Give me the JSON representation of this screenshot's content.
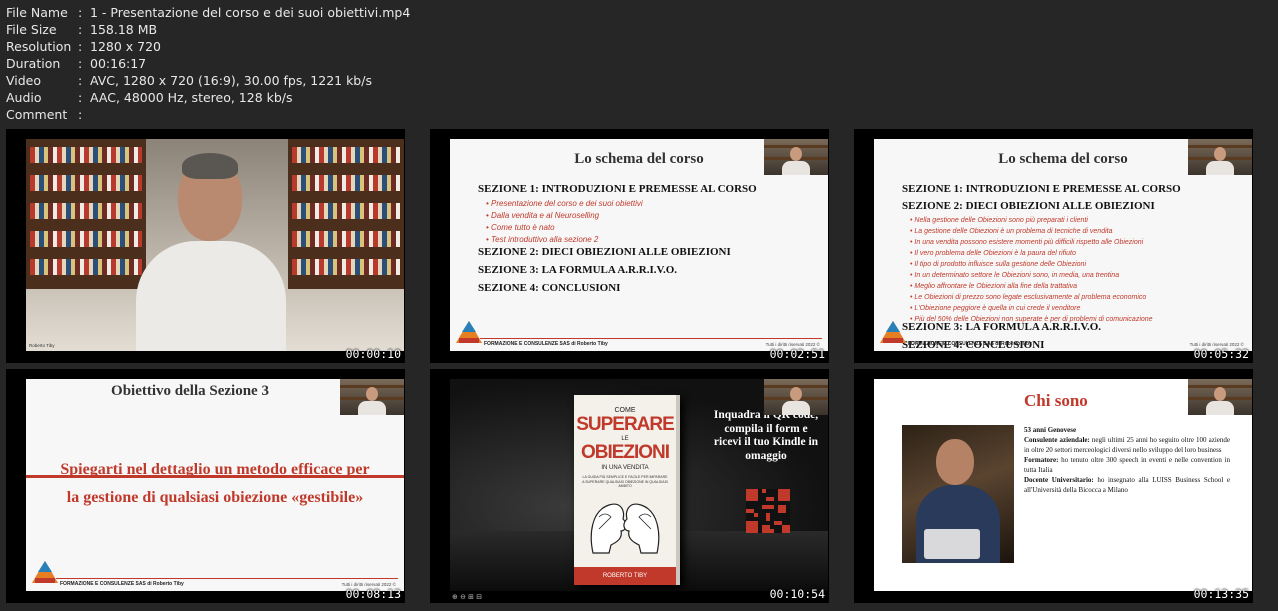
{
  "file_info": [
    {
      "key": "File Name",
      "value": "1 - Presentazione del corso e dei suoi obiettivi.mp4"
    },
    {
      "key": "File Size",
      "value": "158.18 MB"
    },
    {
      "key": "Resolution",
      "value": "1280 x 720"
    },
    {
      "key": "Duration",
      "value": "00:16:17"
    },
    {
      "key": "Video",
      "value": "AVC, 1280 x 720 (16:9), 30.00 fps, 1221 kb/s"
    },
    {
      "key": "Audio",
      "value": "AAC, 48000 Hz, stereo, 128 kb/s"
    },
    {
      "key": "Comment",
      "value": ""
    }
  ],
  "separator": ":",
  "thumbnails": [
    {
      "timestamp": "00:00:10",
      "name_tag": "Roberto Tiby"
    },
    {
      "timestamp": "00:02:51"
    },
    {
      "timestamp": "00:05:32"
    },
    {
      "timestamp": "00:08:13"
    },
    {
      "timestamp": "00:10:54"
    },
    {
      "timestamp": "00:13:35"
    }
  ],
  "slides": {
    "footer": "FORMAZIONE E CONSULENZE SAS di Roberto Tiby",
    "footer_right": "Tutti i diritti riservati 2022 ©",
    "schema": {
      "title": "Lo schema del corso",
      "s1": "SEZIONE 1: INTRODUZIONI E PREMESSE AL CORSO",
      "s1_bullets": [
        "Presentazione del corso e dei suoi obiettivi",
        "Dalla vendita e al Neuroselling",
        "Come tutto è nato",
        "Test introduttivo alla sezione 2"
      ],
      "s2": "SEZIONE 2: DIECI OBIEZIONI ALLE OBIEZIONI",
      "s2_bullets": [
        "Nella gestione delle Obiezioni sono più preparati i clienti",
        "La gestione delle Obiezioni è un problema di tecniche di vendita",
        "In una vendita possono esistere momenti più difficili rispetto alle Obiezioni",
        "Il vero problema delle Obiezioni è la paura del rifiuto",
        "Il tipo di prodotto influisce sulla gestione delle Obiezioni",
        "In un determinato settore le Obiezioni sono, in media, una trentina",
        "Meglio affrontare le Obiezioni alla fine della trattativa",
        "Le Obiezioni di prezzo sono legate esclusivamente al problema economico",
        "L'Obiezione peggiore è quella in cui crede il venditore",
        "Più del 50% delle Obiezioni non superate è per di problemi di comunicazione"
      ],
      "s3": "SEZIONE 3: LA FORMULA A.R.R.I.V.O.",
      "s4": "SEZIONE 4: CONCLUSIONI"
    },
    "obiettivo": {
      "title": "Obiettivo della Sezione 3",
      "line1": "Spiegarti nel dettaglio un metodo efficace per",
      "line2": "la gestione di qualsiasi obiezione «gestibile»"
    },
    "book": {
      "cover_top": "COME",
      "cover_big1": "SUPERARE",
      "cover_le": "LE",
      "cover_big2": "OBIEZIONI",
      "cover_sub": "IN UNA VENDITA",
      "cover_small": "LA GUIDA PIÙ SEMPLICE E FACILE PER IMPARARE A SUPERARE QUALSIASI OBIEZIONE IN QUALSIASI AMBITO",
      "cover_author": "ROBERTO TIBY",
      "promo": "Inquadra il QR code, compila il form e ricevi il tuo Kindle in omaggio"
    },
    "chi_sono": {
      "title": "Chi sono",
      "age": "53 anni Genovese",
      "p1_label": "Consulente aziendale:",
      "p1_text": " negli ultimi 25 anni ho seguito oltre 100 aziende in oltre 20 settori merceologici diversi nello sviluppo del loro business",
      "p2_label": "Formatore:",
      "p2_text": " ho tenuto oltre 300 speech in eventi e nelle convention in tutta Italia",
      "p3_label": "Docente Universitario:",
      "p3_text": " ho insegnato alla LUISS Business School e all'Università della Bicocca a Milano"
    }
  }
}
